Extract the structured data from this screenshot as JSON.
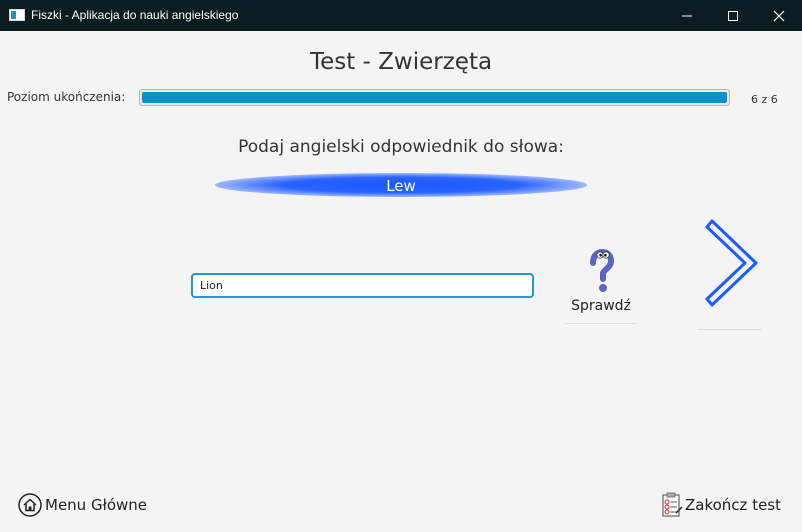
{
  "window": {
    "title": "Fiszki - Aplikacja do nauki angielskiego",
    "icons": {
      "app": "flashcard-app-icon",
      "minimize": "minimize-icon",
      "maximize": "maximize-icon",
      "close": "close-icon"
    }
  },
  "header": {
    "title": "Test - Zwierzęta"
  },
  "progress": {
    "label": "Poziom ukończenia:",
    "count_text": "6 z 6",
    "current": 6,
    "total": 6,
    "fraction": 1.0,
    "color": "#0a92c6"
  },
  "question": {
    "prompt": "Podaj angielski odpowiednik do słowa:",
    "word": "Lew",
    "highlight_color": "#1a57ff"
  },
  "answer": {
    "value": "Lion",
    "focus_color": "#1c9ad6"
  },
  "check": {
    "label": "Sprawdź",
    "icon": "question-mark-icon"
  },
  "next": {
    "icon": "chevron-right-icon",
    "color": "#1a5cff"
  },
  "footer": {
    "menu_label": "Menu Główne",
    "menu_icon": "home-icon",
    "finish_label": "Zakończ test",
    "finish_icon": "checklist-icon"
  }
}
